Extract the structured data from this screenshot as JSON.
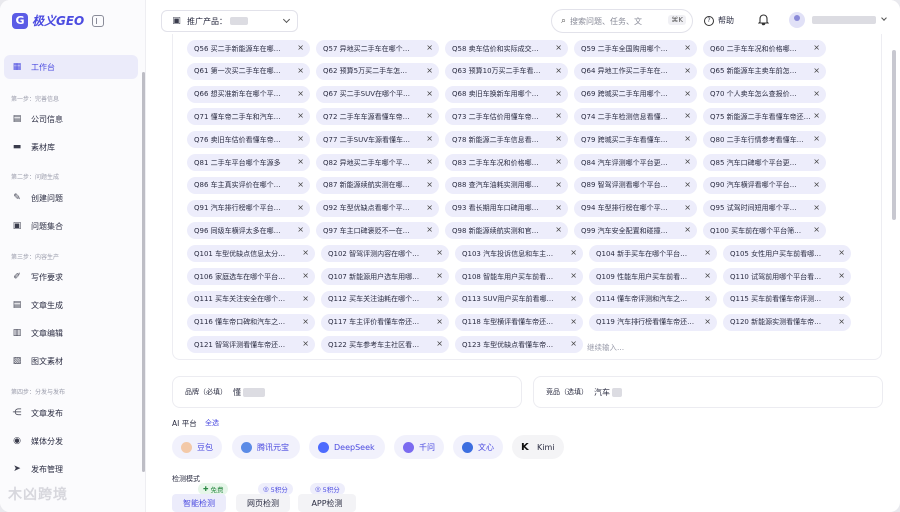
{
  "app": {
    "logo_text": "极义GEO"
  },
  "sidebar": {
    "active": {
      "label": "工作台"
    },
    "sections": [
      {
        "label": "第一步：完善信息",
        "items": [
          "公司信息",
          "素材库"
        ]
      },
      {
        "label": "第二步：问题生成",
        "items": [
          "创建问题",
          "问题集合"
        ]
      },
      {
        "label": "第三步：内容生产",
        "items": [
          "写作要求",
          "文章生成",
          "文章编辑",
          "图文素材"
        ]
      },
      {
        "label": "第四步：分发与发布",
        "items": [
          "文章发布",
          "媒体分发",
          "发布管理"
        ]
      }
    ],
    "watermark": "木凶跨境"
  },
  "header": {
    "product_label": "推广产品：",
    "search_placeholder": "搜索问题、任务、文",
    "search_shortcut": "⌘K",
    "help_label": "帮助"
  },
  "tags": [
    "Q56 买二手新能源车在哪…",
    "Q57 异地买二手车在哪个…",
    "Q58 卖车估价和实际成交…",
    "Q59 二手车全国购用哪个…",
    "Q60 二手车车况和价格哪…",
    "Q61 第一次买二手车在哪…",
    "Q62 预算5万买二手车怎…",
    "Q63 预算10万买二手车看…",
    "Q64 异地工作买二手车在…",
    "Q65 新能源车主卖车前怎…",
    "Q66 想买准新车在哪个平…",
    "Q67 买二手SUV在哪个平…",
    "Q68 卖旧车换新车用哪个…",
    "Q69 跨城买二手车用哪个…",
    "Q70 个人卖车怎么查报价…",
    "Q71 懂车帝二手车和汽车…",
    "Q72 二手车车源看懂车帝…",
    "Q73 二手车估价用懂车帝…",
    "Q74 二手车检测信息看懂…",
    "Q75 新能源二手车看懂车帝还…",
    "Q76 卖旧车估价看懂车帝…",
    "Q77 二手SUV车源看懂车…",
    "Q78 新能源二手车信息看…",
    "Q79 跨城买二手车看懂车…",
    "Q80 二手车行情参考看懂车…",
    "Q81 二手车平台哪个车源多",
    "Q82 异地买二手车哪个平…",
    "Q83 二手车车况和价格哪…",
    "Q84 汽车评测哪个平台更…",
    "Q85 汽车口碑哪个平台更…",
    "Q86 车主真实评价在哪个…",
    "Q87 新能源续航实测在哪…",
    "Q88 查汽车油耗实测用哪…",
    "Q89 智驾评测看哪个平台…",
    "Q90 汽车横评看哪个平台…",
    "Q91 汽车排行榜哪个平台…",
    "Q92 车型优缺点看哪个平…",
    "Q93 看长期用车口碑用哪…",
    "Q94 车型排行榜在哪个平…",
    "Q95 试驾时间短用哪个平…",
    "Q96 同级车横评太多在哪…",
    "Q97 车主口碑褒贬不一在…",
    "Q98 新能源续航实测和官…",
    "Q99 汽车安全配置和碰撞…",
    "Q100 买车前在哪个平台筛…",
    "Q101 车型优缺点信息太分…",
    "Q102 智驾评测内容在哪个…",
    "Q103 汽车投诉信息和车主…",
    "Q104 新手买车在哪个平台…",
    "Q105 女性用户买车前看哪…",
    "Q106 家庭选车在哪个平台…",
    "Q107 新能源用户选车用哪…",
    "Q108 智能车用户买车前看…",
    "Q109 性能车用户买车前看…",
    "Q110 试驾前用哪个平台看…",
    "Q111 买车关注安全在哪个…",
    "Q112 买车关注油耗在哪个…",
    "Q113 SUV用户买车前看哪…",
    "Q114 懂车帝评测和汽车之…",
    "Q115 买车前看懂车帝评测…",
    "Q116 懂车帝口碑和汽车之…",
    "Q117 车主评价看懂车帝还…",
    "Q118 车型横评看懂车帝还…",
    "Q119 汽车排行榜看懂车帝还…",
    "Q120 新能源实测看懂车帝…",
    "Q121 智驾评测看懂车帝还…",
    "Q122 买车参考车主社区看…",
    "Q123 车型优缺点看懂车帝…"
  ],
  "continue_input_placeholder": "继续输入...",
  "brand_field": {
    "label": "品牌（必填）",
    "value": "懂"
  },
  "competitor_field": {
    "label": "竞品（选填）",
    "value": "汽车"
  },
  "ai_platform": {
    "label": "AI 平台",
    "select_all": "全选",
    "items": [
      "豆包",
      "腾讯元宝",
      "DeepSeek",
      "千问",
      "文心",
      "Kimi"
    ]
  },
  "detection_mode": {
    "label": "检测模式",
    "modes": [
      {
        "label": "智能检测",
        "badge": "免费"
      },
      {
        "label": "网页检测",
        "badge": "5积分"
      },
      {
        "label": "APP检测",
        "badge": "5积分"
      }
    ]
  }
}
